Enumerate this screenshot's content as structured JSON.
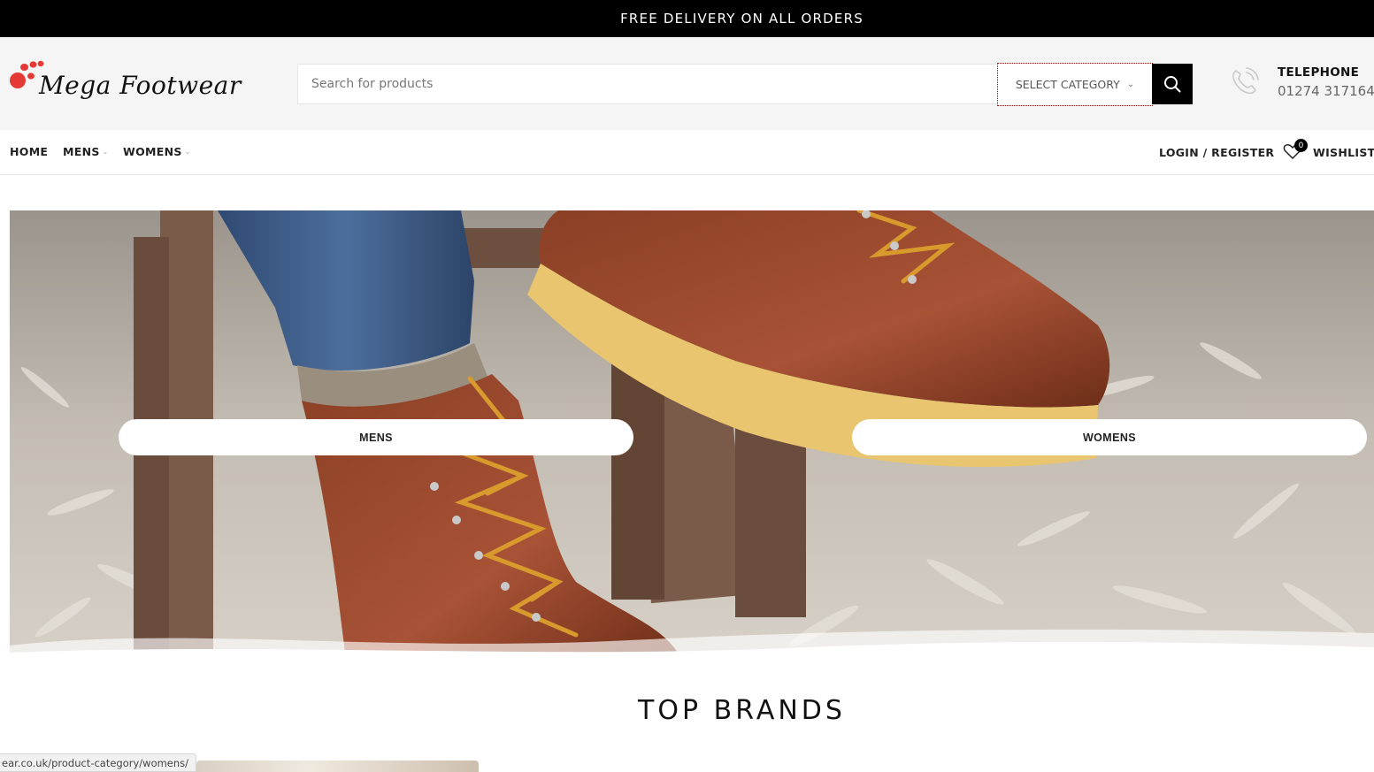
{
  "promo_bar": {
    "text": "FREE DELIVERY ON ALL ORDERS"
  },
  "brand": {
    "name": "Mega Footwear",
    "accent_color": "#e53935"
  },
  "search": {
    "placeholder": "Search for products",
    "category_label": "SELECT CATEGORY"
  },
  "contact": {
    "title": "TELEPHONE",
    "number": "01274 317164"
  },
  "nav": {
    "items": [
      {
        "label": "HOME",
        "has_dropdown": false
      },
      {
        "label": "MENS",
        "has_dropdown": true
      },
      {
        "label": "WOMENS",
        "has_dropdown": true
      }
    ],
    "login_label": "LOGIN / REGISTER",
    "wishlist_label": "WISHLIST",
    "wishlist_count": "0"
  },
  "hero": {
    "buttons": [
      {
        "label": "MENS"
      },
      {
        "label": "WOMENS"
      }
    ]
  },
  "sections": {
    "top_brands_title": "TOP BRANDS"
  },
  "status_bar": {
    "url": "ear.co.uk/product-category/womens/"
  },
  "icons": {
    "search": "search-icon",
    "phone": "phone-icon",
    "wishlist": "heart-icon",
    "dropdown": "chevron-down-icon"
  }
}
